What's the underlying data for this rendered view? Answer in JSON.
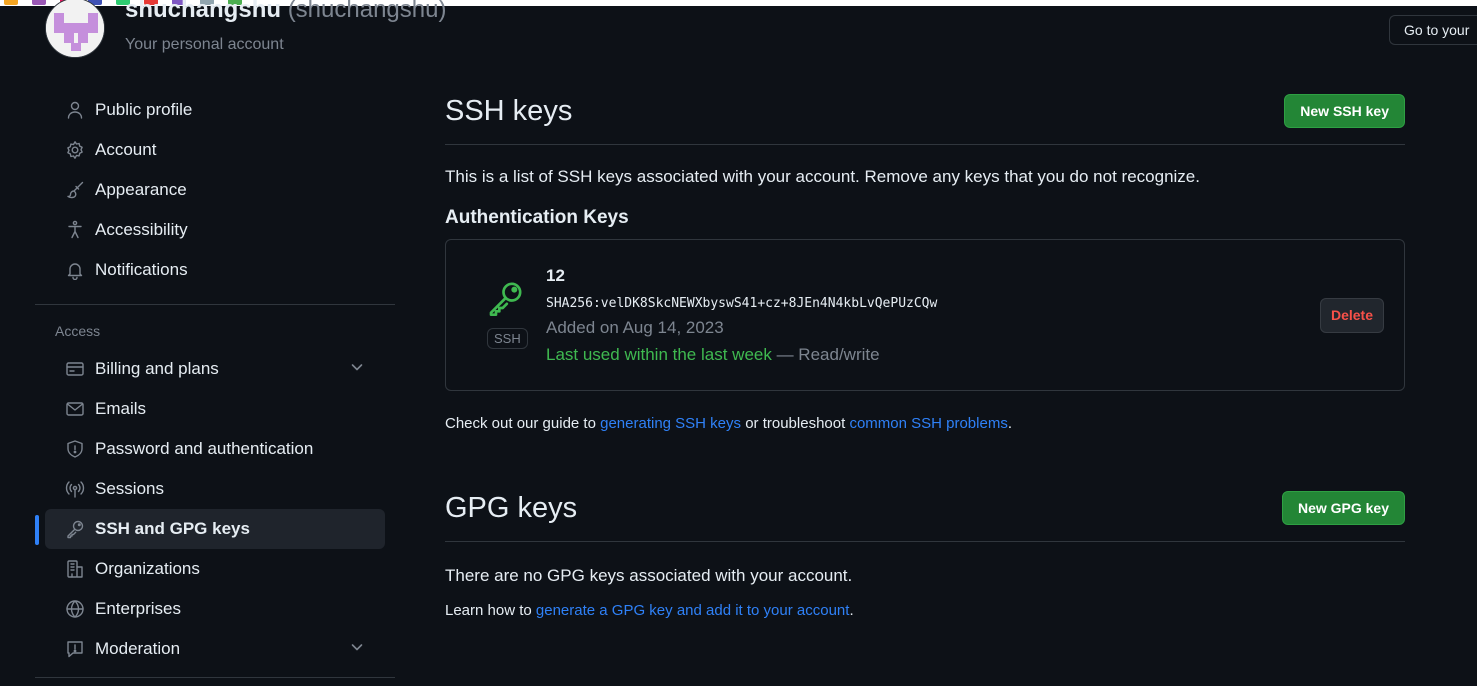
{
  "browser": {
    "goto_label": "Go to your"
  },
  "profile": {
    "username": "shuchangshu",
    "login": "(shuchangshu)",
    "subtitle": "Your personal account"
  },
  "sidebar": {
    "items_top": [
      {
        "label": "Public profile",
        "icon": "person-icon"
      },
      {
        "label": "Account",
        "icon": "gear-icon"
      },
      {
        "label": "Appearance",
        "icon": "paintbrush-icon"
      },
      {
        "label": "Accessibility",
        "icon": "accessibility-icon"
      },
      {
        "label": "Notifications",
        "icon": "bell-icon"
      }
    ],
    "access_label": "Access",
    "items_access": [
      {
        "label": "Billing and plans",
        "icon": "credit-card-icon",
        "expandable": true
      },
      {
        "label": "Emails",
        "icon": "mail-icon"
      },
      {
        "label": "Password and authentication",
        "icon": "shield-icon"
      },
      {
        "label": "Sessions",
        "icon": "broadcast-icon"
      },
      {
        "label": "SSH and GPG keys",
        "icon": "key-icon",
        "active": true
      },
      {
        "label": "Organizations",
        "icon": "organization-icon"
      },
      {
        "label": "Enterprises",
        "icon": "globe-icon"
      },
      {
        "label": "Moderation",
        "icon": "report-icon",
        "expandable": true
      }
    ]
  },
  "ssh": {
    "title": "SSH keys",
    "new_button": "New SSH key",
    "description": "This is a list of SSH keys associated with your account. Remove any keys that you do not recognize.",
    "auth_heading": "Authentication Keys",
    "key": {
      "title": "12",
      "fingerprint": "SHA256:velDK8SkcNEWXbyswS41+cz+8JEn4N4kbLvQePUzCQw",
      "added": "Added on Aug 14, 2023",
      "last_used": "Last used within the last week",
      "access": " — Read/write",
      "badge": "SSH",
      "delete_button": "Delete"
    },
    "note_prefix": "Check out our guide to ",
    "note_link1": "generating SSH keys",
    "note_mid": " or troubleshoot ",
    "note_link2": "common SSH problems",
    "note_suffix": "."
  },
  "gpg": {
    "title": "GPG keys",
    "new_button": "New GPG key",
    "description": "There are no GPG keys associated with your account.",
    "learn_prefix": "Learn how to ",
    "learn_link": "generate a GPG key and add it to your account",
    "learn_suffix": "."
  },
  "colors": {
    "background": "#0d1117",
    "accent_blue": "#2f81f7",
    "green_button": "#238636",
    "success_text": "#3fb950",
    "danger_text": "#f85149"
  }
}
